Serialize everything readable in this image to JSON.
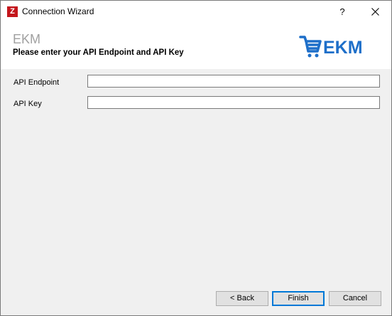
{
  "window": {
    "title": "Connection Wizard",
    "app_icon_letter": "Z",
    "help_label": "?"
  },
  "header": {
    "title": "EKM",
    "subtitle": "Please enter your API Endpoint and API Key",
    "logo_text": "EKM",
    "logo_color": "#1e6fc9"
  },
  "form": {
    "api_endpoint": {
      "label": "API Endpoint",
      "value": ""
    },
    "api_key": {
      "label": "API Key",
      "value": ""
    }
  },
  "buttons": {
    "back": "< Back",
    "finish": "Finish",
    "cancel": "Cancel"
  },
  "colors": {
    "accent": "#0078d7",
    "app_icon": "#c4161c"
  }
}
